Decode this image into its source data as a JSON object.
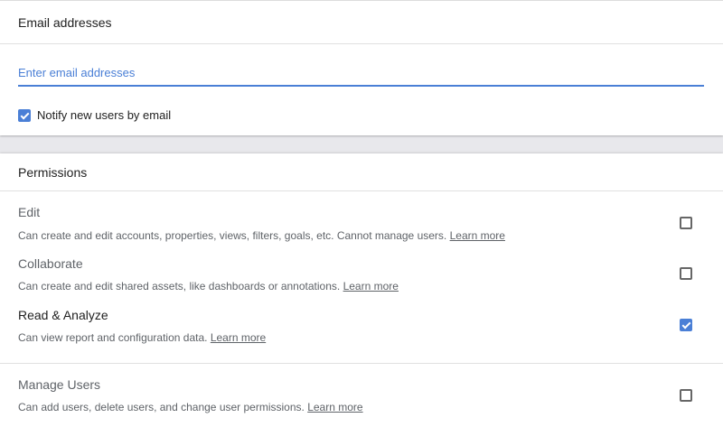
{
  "email_section": {
    "title": "Email addresses",
    "input_placeholder": "Enter email addresses",
    "notify_label": "Notify new users by email",
    "notify_checked": true
  },
  "permissions_section": {
    "title": "Permissions",
    "items": [
      {
        "title": "Edit",
        "description": "Can create and edit accounts, properties, views, filters, goals, etc. Cannot manage users.",
        "link": "Learn more",
        "checked": false
      },
      {
        "title": "Collaborate",
        "description": "Can create and edit shared assets, like dashboards or annotations.",
        "link": "Learn more",
        "checked": false
      },
      {
        "title": "Read & Analyze",
        "description": "Can view report and configuration data.",
        "link": "Learn more",
        "checked": true
      },
      {
        "title": "Manage Users",
        "description": "Can add users, delete users, and change user permissions.",
        "link": "Learn more",
        "checked": false
      }
    ]
  },
  "colors": {
    "accent": "#4a7fd6",
    "background": "#e8e8ec"
  }
}
